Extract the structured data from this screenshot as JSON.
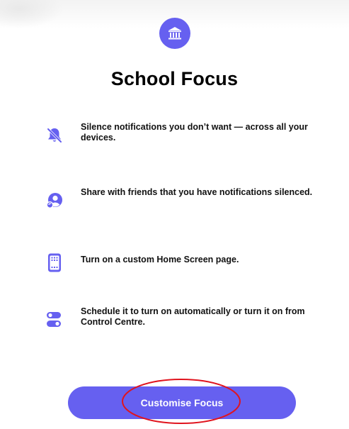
{
  "header": {
    "icon": "building-columns-icon",
    "title": "School Focus"
  },
  "features": [
    {
      "icon": "bell-slash-icon",
      "text": "Silence notifications you don’t want — across all your devices."
    },
    {
      "icon": "share-status-icon",
      "text": "Share with friends that you have notifications silenced."
    },
    {
      "icon": "home-screen-page-icon",
      "text": "Turn on a custom Home Screen page."
    },
    {
      "icon": "toggle-switches-icon",
      "text": "Schedule it to turn on automatically or turn it on from Control Centre."
    }
  ],
  "cta": {
    "label": "Customise Focus"
  },
  "colors": {
    "accent": "#6660f0",
    "annotation": "#e0141e"
  }
}
